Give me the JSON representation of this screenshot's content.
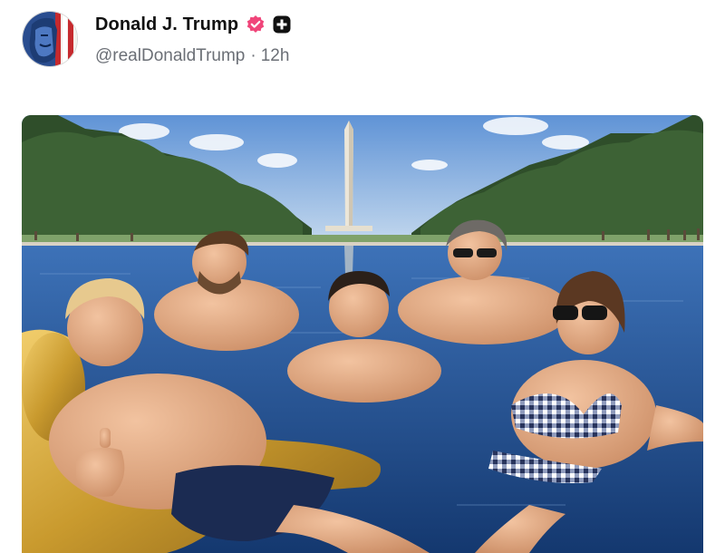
{
  "post": {
    "author": {
      "display_name": "Donald J. Trump",
      "handle": "@realDonaldTrump",
      "verified_icon": "verified-badge-icon",
      "badge_icon": "plus-badge-icon",
      "avatar_icon": "avatar-flag-portrait"
    },
    "separator": "·",
    "timestamp": "12h"
  },
  "media": {
    "type": "photo",
    "icon": "post-image"
  },
  "colors": {
    "verified": "#f0457a",
    "handle_text": "#6b6f76",
    "name_text": "#111111"
  }
}
